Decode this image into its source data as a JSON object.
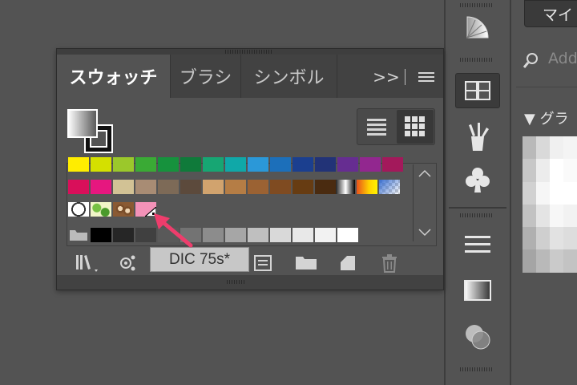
{
  "panel": {
    "tabs": [
      {
        "label": "スウォッチ",
        "active": true
      },
      {
        "label": "ブラシ",
        "active": false
      },
      {
        "label": "シンボル",
        "active": false
      }
    ],
    "overflow_label": ">>",
    "menu_icon": "hamburger-menu-icon",
    "view_list_icon": "list-view-icon",
    "view_grid_icon": "grid-view-icon",
    "swatch_rows": [
      [
        "#ffed00",
        "#d4e000",
        "#9bc82b",
        "#3aaa35",
        "#16923d",
        "#0f7a3a",
        "#17a673",
        "#10a8a8",
        "#2b98d8",
        "#1c6fba",
        "#1b3f8f",
        "#223377",
        "#662d91",
        "#92278f",
        "#a3195b"
      ],
      [
        "#d90f5a",
        "#e6177f",
        "#d2c295",
        "#a88c74",
        "#7d6a57",
        "#5c4a3c",
        "#d1a36e",
        "#b57d45",
        "#9b6233",
        "#7f4b21",
        "#673c12",
        "#4a2b10"
      ]
    ],
    "gradient_swatches": [
      "black-white-gradient",
      "orange-yellow-gradient",
      "blue-transparent-gradient"
    ],
    "pattern_swatches": [
      "dots-pattern",
      "leaf-pattern",
      "swirl-pattern"
    ],
    "grey_swatches": [
      "#000000",
      "#262626",
      "#404040",
      "#595959",
      "#737373",
      "#8c8c8c",
      "#a6a6a6",
      "#bfbfbf",
      "#d9d9d9",
      "#e8e8e8",
      "#f2f2f2",
      "#ffffff"
    ],
    "selected_swatch_color": "#f392b8",
    "bottom_icons": [
      "swatch-library-icon",
      "show-kinds-icon",
      "swatch-options-icon",
      "new-color-group-icon",
      "new-swatch-icon",
      "delete-swatch-icon"
    ]
  },
  "tooltip": {
    "text": "DIC 75s*"
  },
  "arrow_color": "#ee3d6c",
  "right_panel": {
    "dropdown_label": "マイ",
    "search_placeholder": "Add",
    "section_title": "▼ グラ"
  },
  "dock": {
    "icons": [
      "gradient-fan-icon",
      "swatches-icon",
      "brushes-icon",
      "club-symbol-icon",
      "stroke-icon",
      "gradient-icon",
      "transparency-icon"
    ]
  }
}
